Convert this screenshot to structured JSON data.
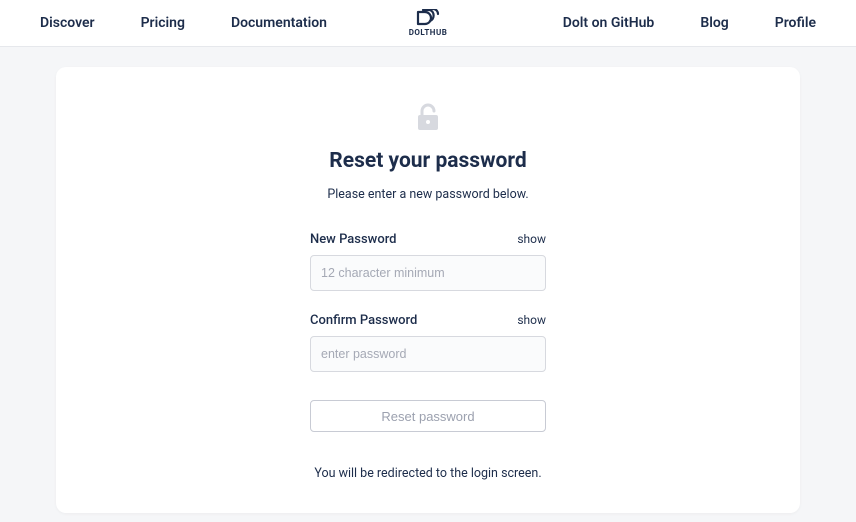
{
  "nav": {
    "left": [
      "Discover",
      "Pricing",
      "Documentation"
    ],
    "right": [
      "Dolt on GitHub",
      "Blog",
      "Profile"
    ],
    "brand": "DOLTHUB"
  },
  "page": {
    "title": "Reset your password",
    "subtitle": "Please enter a new password below.",
    "redirect_note": "You will be redirected to the login screen."
  },
  "form": {
    "new_password": {
      "label": "New Password",
      "placeholder": "12 character minimum",
      "toggle": "show"
    },
    "confirm_password": {
      "label": "Confirm Password",
      "placeholder": "enter password",
      "toggle": "show"
    },
    "submit_label": "Reset password"
  },
  "colors": {
    "text": "#1d2d4b",
    "muted": "#9ca1af",
    "border": "#d7d9df",
    "bg": "#f5f6f8"
  }
}
